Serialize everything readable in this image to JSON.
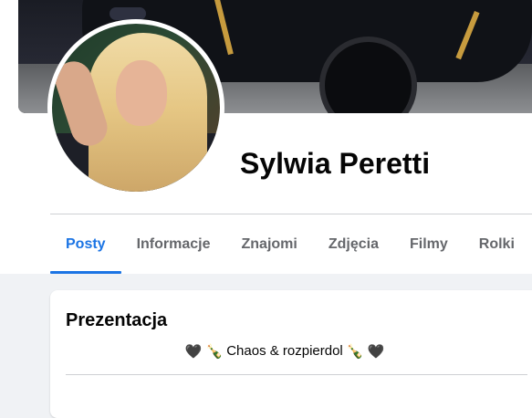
{
  "profile": {
    "name": "Sylwia Peretti"
  },
  "tabs": [
    {
      "label": "Posty",
      "active": true
    },
    {
      "label": "Informacje",
      "active": false
    },
    {
      "label": "Znajomi",
      "active": false
    },
    {
      "label": "Zdjęcia",
      "active": false
    },
    {
      "label": "Filmy",
      "active": false
    },
    {
      "label": "Rolki",
      "active": false
    }
  ],
  "intro": {
    "title": "Prezentacja",
    "bio_text": "Chaos & rozpierdol",
    "bio_emoji_left": [
      "🖤",
      "🍾"
    ],
    "bio_emoji_right": [
      "🍾",
      "🖤"
    ]
  },
  "colors": {
    "accent": "#1b74e4",
    "tab_text": "#65676b",
    "page_bg": "#f0f2f5"
  }
}
